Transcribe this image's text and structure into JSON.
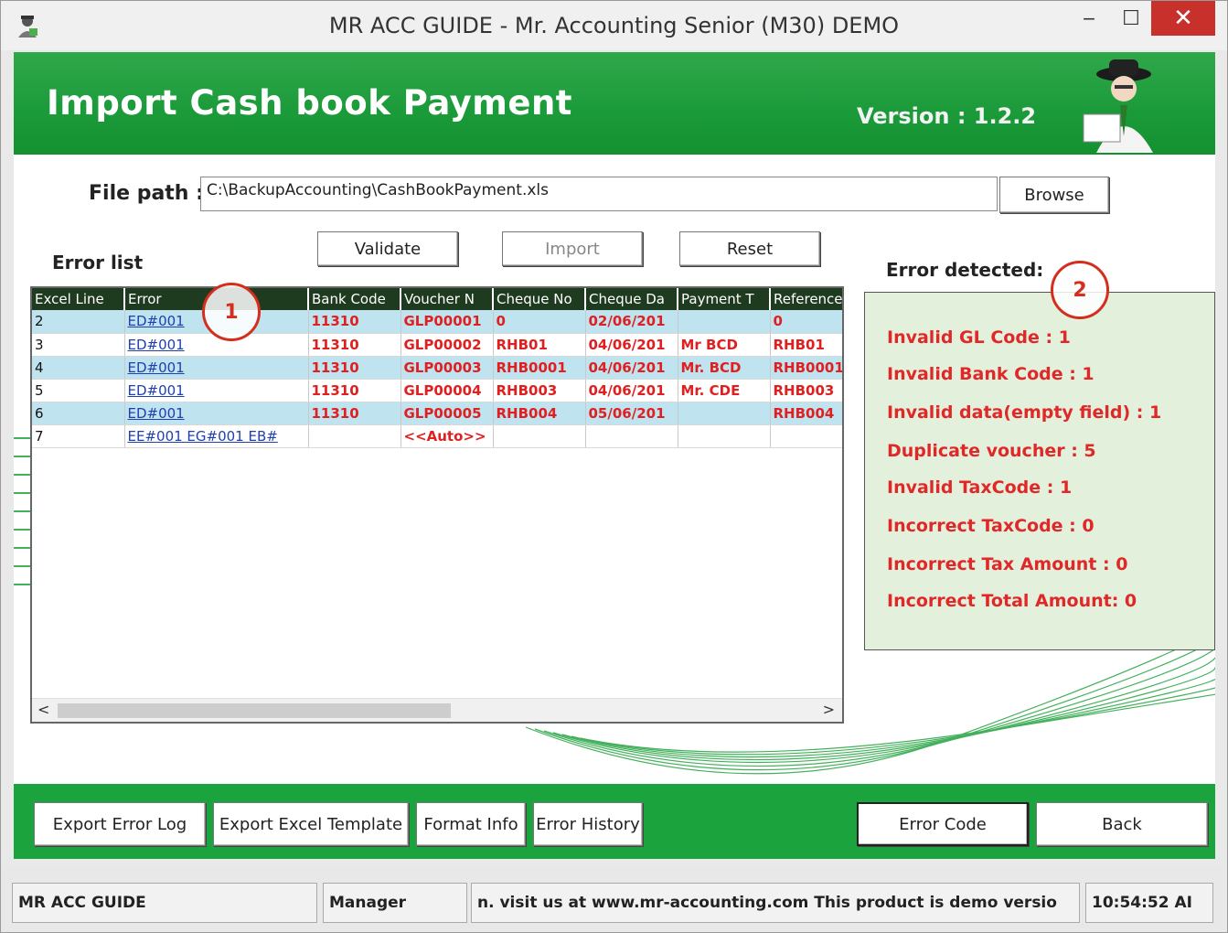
{
  "window": {
    "title": "MR ACC GUIDE - Mr. Accounting Senior (M30) DEMO",
    "controls": {
      "minimize": "‒",
      "maximize": "☐",
      "close": "✕"
    }
  },
  "banner": {
    "title": "Import Cash book Payment",
    "version": "Version : 1.2.2"
  },
  "form": {
    "file_path_label": "File path :",
    "file_path_value": "C:\\BackupAccounting\\CashBookPayment.xls",
    "browse_label": "Browse",
    "validate_label": "Validate",
    "import_label": "Import",
    "reset_label": "Reset",
    "error_list_label": "Error list",
    "error_detected_label": "Error detected:"
  },
  "grid": {
    "columns": [
      "Excel Line",
      "Error",
      "Bank Code",
      "Voucher N",
      "Cheque No",
      "Cheque Da",
      "Payment T",
      "Reference"
    ],
    "rows": [
      [
        "2",
        "ED#001",
        "11310",
        "GLP00001",
        "0",
        "02/06/201",
        "",
        "0"
      ],
      [
        "3",
        "ED#001",
        "11310",
        "GLP00002",
        "RHB01",
        "04/06/201",
        "Mr BCD",
        "RHB01"
      ],
      [
        "4",
        "ED#001",
        "11310",
        "GLP00003",
        "RHB0001",
        "04/06/201",
        "Mr. BCD",
        "RHB0001"
      ],
      [
        "5",
        "ED#001",
        "11310",
        "GLP00004",
        "RHB003",
        "04/06/201",
        "Mr. CDE",
        "RHB003"
      ],
      [
        "6",
        "ED#001",
        "11310",
        "GLP00005",
        "RHB004",
        "05/06/201",
        "",
        "RHB004"
      ],
      [
        "7",
        "EE#001 EG#001 EB#",
        "",
        "<<Auto>>",
        "",
        "",
        "",
        ""
      ]
    ],
    "scroll_left": "<",
    "scroll_right": ">"
  },
  "errors": [
    "Invalid GL Code : 1",
    "Invalid Bank Code : 1",
    "Invalid data(empty field) : 1",
    "Duplicate voucher : 5",
    "Invalid TaxCode : 1",
    "Incorrect TaxCode : 0",
    "Incorrect Tax Amount : 0",
    "Incorrect Total Amount: 0"
  ],
  "callouts": {
    "one": "1",
    "two": "2"
  },
  "buttons": {
    "export_error_log": "Export Error Log",
    "export_excel_template": "Export Excel Template",
    "format_info": "Format Info",
    "error_history": "Error History",
    "error_code": "Error Code",
    "back": "Back"
  },
  "status": {
    "app": "MR ACC GUIDE",
    "user": "Manager",
    "message": "n.  visit us at www.mr-accounting.com This product is demo versio",
    "time": "10:54:52 AI"
  },
  "colors": {
    "banner_green": "#1b9a3a",
    "bottom_green": "#1ba33d",
    "error_red": "#e02828",
    "grid_header": "#1f3b1f",
    "row_alt": "#bfe3ef",
    "panel_bg": "#e3f0dc"
  }
}
